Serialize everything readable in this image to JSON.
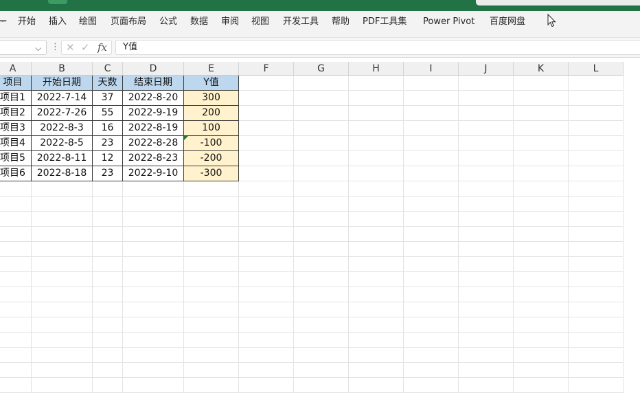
{
  "ribbon": {
    "tabs": [
      "开始",
      "插入",
      "绘图",
      "页面布局",
      "公式",
      "数据",
      "审阅",
      "视图",
      "开发工具",
      "帮助",
      "PDF工具集",
      "Power Pivot",
      "百度网盘"
    ]
  },
  "formula_bar": {
    "value": "Y值"
  },
  "columns": [
    "A",
    "B",
    "C",
    "D",
    "E",
    "F",
    "G",
    "H",
    "I",
    "J",
    "K",
    "L"
  ],
  "table": {
    "headers": [
      "项目",
      "开始日期",
      "天数",
      "结束日期",
      "Y值"
    ],
    "rows": [
      [
        "项目1",
        "2022-7-14",
        "37",
        "2022-8-20",
        "300"
      ],
      [
        "项目2",
        "2022-7-26",
        "55",
        "2022-9-19",
        "200"
      ],
      [
        "项目3",
        "2022-8-3",
        "16",
        "2022-8-19",
        "100"
      ],
      [
        "项目4",
        "2022-8-5",
        "23",
        "2022-8-28",
        "-100"
      ],
      [
        "项目5",
        "2022-8-11",
        "12",
        "2022-8-23",
        "-200"
      ],
      [
        "项目6",
        "2022-8-18",
        "23",
        "2022-9-10",
        "-300"
      ]
    ]
  },
  "colors": {
    "title_bar": "#217346",
    "header_fill": "#bdd7ee",
    "y_value_fill": "#fff2cc"
  }
}
